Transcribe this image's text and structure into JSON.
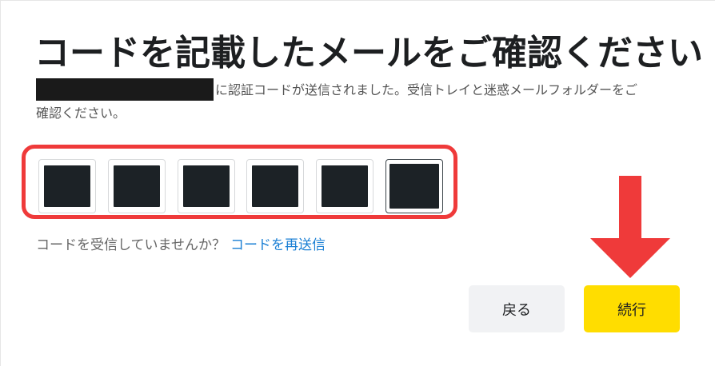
{
  "dialog": {
    "title": "コードを記載したメールをご確認ください",
    "description_line1": "に認証コードが送信されました。受信トレイと迷惑メールフォルダーをご",
    "description_line2": "確認ください。",
    "code_length": 6,
    "resend_prompt": "コードを受信していませんか？",
    "resend_link": "コードを再送信",
    "back_label": "戻る",
    "continue_label": "続行"
  },
  "colors": {
    "highlight_border": "#ef3a3a",
    "continue_button": "#ffdd00",
    "back_button": "#f1f2f4",
    "link": "#1a7fd4",
    "arrow": "#ef3a3a"
  }
}
